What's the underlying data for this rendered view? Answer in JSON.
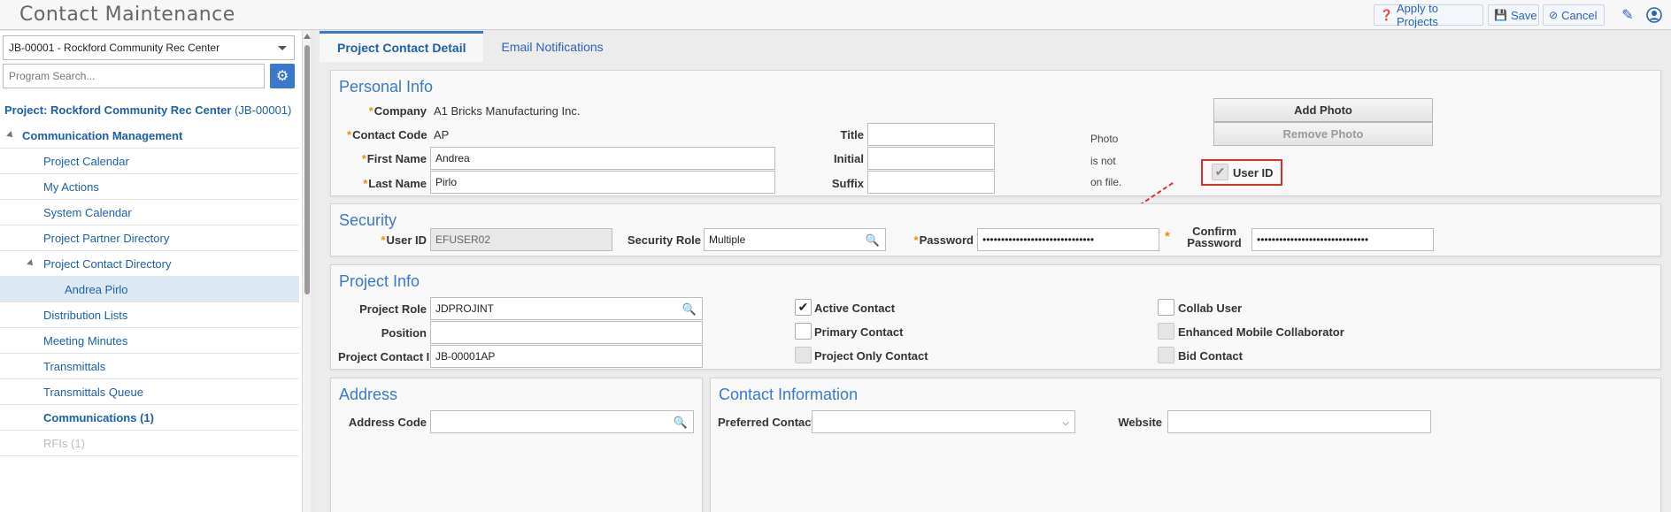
{
  "header": {
    "title": "Contact Maintenance",
    "apply_label": "Apply to Projects",
    "save_label": "Save",
    "cancel_label": "Cancel"
  },
  "sidebar": {
    "project_select": "JB-00001 - Rockford Community Rec Center",
    "search_placeholder": "Program Search...",
    "project_heading": "Project: Rockford Community Rec Center",
    "project_id": "(JB-00001)",
    "items": [
      {
        "label": "Communication Management"
      },
      {
        "label": "Project Calendar"
      },
      {
        "label": "My Actions"
      },
      {
        "label": "System Calendar"
      },
      {
        "label": "Project Partner Directory"
      },
      {
        "label": "Project Contact Directory"
      },
      {
        "label": "Andrea Pirlo"
      },
      {
        "label": "Distribution Lists"
      },
      {
        "label": "Meeting Minutes"
      },
      {
        "label": "Transmittals"
      },
      {
        "label": "Transmittals Queue"
      },
      {
        "label": "Communications (1)"
      },
      {
        "label": "RFIs (1)"
      }
    ]
  },
  "tabs": {
    "detail": "Project Contact Detail",
    "email": "Email Notifications"
  },
  "personal": {
    "title": "Personal Info",
    "company_label": "Company",
    "company_value": "A1 Bricks Manufacturing Inc.",
    "contact_code_label": "Contact Code",
    "contact_code_value": "AP",
    "first_name_label": "First Name",
    "first_name_value": "Andrea",
    "last_name_label": "Last Name",
    "last_name_value": "Pirlo",
    "title_label": "Title",
    "initial_label": "Initial",
    "suffix_label": "Suffix",
    "photo_line1": "Photo",
    "photo_line2": "is not",
    "photo_line3": "on file.",
    "add_photo": "Add Photo",
    "remove_photo": "Remove Photo",
    "user_id_cb": "User ID"
  },
  "security": {
    "title": "Security",
    "user_id_label": "User ID",
    "user_id_value": "EFUSER02",
    "role_label": "Security Role",
    "role_value": "Multiple",
    "password_label": "Password",
    "password_value": "••••••••••••••••••••••••••••••",
    "confirm_label_1": "Confirm",
    "confirm_label_2": "Password",
    "confirm_value": "••••••••••••••••••••••••••••••"
  },
  "project_info": {
    "title": "Project Info",
    "role_label": "Project Role",
    "role_value": "JDPROJINT",
    "position_label": "Position",
    "contact_id_label": "Project Contact ID",
    "contact_id_value": "JB-00001AP",
    "active_contact": "Active Contact",
    "primary_contact": "Primary Contact",
    "project_only": "Project Only Contact",
    "collab_user": "Collab User",
    "enhanced_mobile": "Enhanced Mobile Collaborator",
    "bid_contact": "Bid Contact"
  },
  "address": {
    "title": "Address",
    "code_label": "Address Code"
  },
  "contact_info": {
    "title": "Contact Information",
    "preferred_label": "Preferred Contact",
    "website_label": "Website"
  },
  "colors": {
    "accent": "#3a78c9",
    "required": "#e8900c",
    "highlight": "#d9302b"
  }
}
